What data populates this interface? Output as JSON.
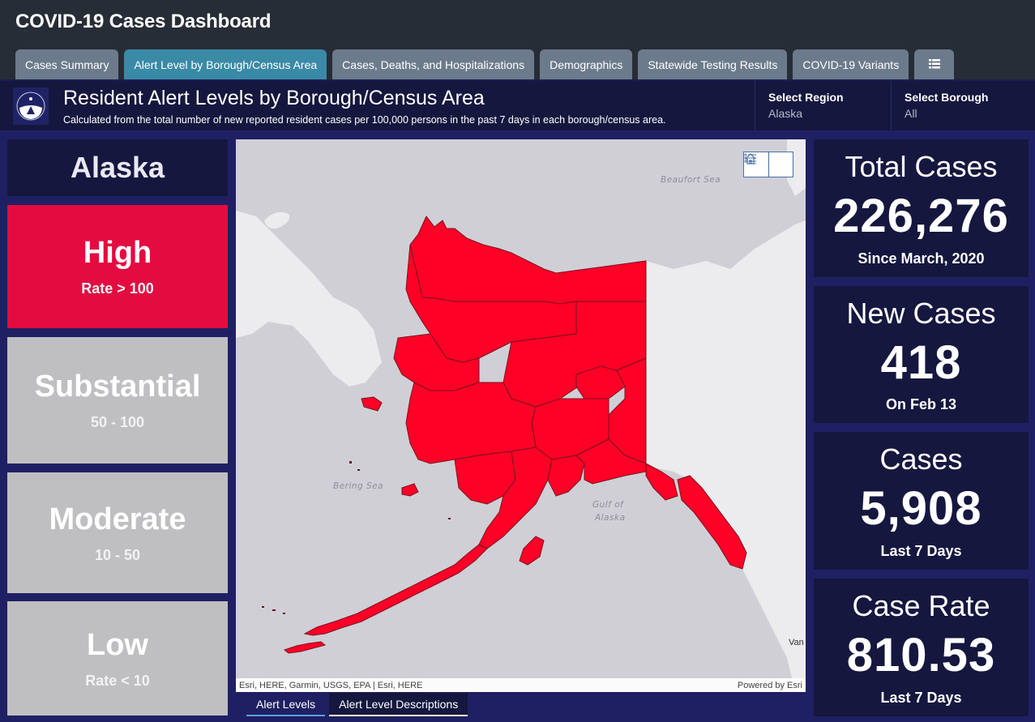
{
  "app": {
    "title": "COVID-19 Cases Dashboard"
  },
  "tabs": [
    {
      "label": "Cases Summary",
      "active": false
    },
    {
      "label": "Alert Level by Borough/Census Area",
      "active": true
    },
    {
      "label": "Cases, Deaths, and Hospitalizations",
      "active": false
    },
    {
      "label": "Demographics",
      "active": false
    },
    {
      "label": "Statewide Testing Results",
      "active": false
    },
    {
      "label": "COVID-19 Variants",
      "active": false
    },
    {
      "label": "☰",
      "icon": "list-menu-icon",
      "active": false
    }
  ],
  "header": {
    "title": "Resident Alert Levels by Borough/Census Area",
    "subtitle": "Calculated from the total number of new reported resident cases per 100,000 persons in the past 7 days in each borough/census area.",
    "logo": "state-of-alaska-seal",
    "region_selector": {
      "label": "Select Region",
      "value": "Alaska"
    },
    "borough_selector": {
      "label": "Select Borough",
      "value": "All"
    }
  },
  "left_panel": {
    "region": "Alaska",
    "levels": [
      {
        "name": "High",
        "range": "Rate > 100",
        "color": "#e30b40",
        "active": true
      },
      {
        "name": "Substantial",
        "range": "50 - 100",
        "color": "#bfbfc2",
        "active": false
      },
      {
        "name": "Moderate",
        "range": "10 - 50",
        "color": "#bfbfc2",
        "active": false
      },
      {
        "name": "Low",
        "range": "Rate < 10",
        "color": "#bfbfc2",
        "active": false
      }
    ]
  },
  "map": {
    "fill_color": "#ff0026",
    "labels": {
      "beaufort": "Beaufort Sea",
      "bering": "Bering Sea",
      "gulf_line1": "Gulf of",
      "gulf_line2": "Alaska",
      "city": "Van"
    },
    "controls": {
      "home": "home-icon",
      "legend": "legend-list-icon"
    },
    "attribution_left": "Esri, HERE, Garmin, USGS, EPA | Esri, HERE",
    "attribution_right": "Powered by Esri"
  },
  "bottom_tabs": [
    {
      "label": "Alert Levels",
      "active": true
    },
    {
      "label": "Alert Level Descriptions",
      "active": false
    }
  ],
  "stats": [
    {
      "title": "Total Cases",
      "value": "226,276",
      "sub": "Since March, 2020"
    },
    {
      "title": "New Cases",
      "value": "418",
      "sub": "On Feb 13"
    },
    {
      "title": "Cases",
      "value": "5,908",
      "sub": "Last 7 Days"
    },
    {
      "title": "Case Rate",
      "value": "810.53",
      "sub": "Last 7 Days"
    }
  ],
  "colors": {
    "topbar": "#272d36",
    "tab": "#6c7b8c",
    "tab_active": "#3a8aa6",
    "panel_bg": "#15173f",
    "page_bg": "#1f2063",
    "high": "#e30b40",
    "inactive_level": "#bfbfc2"
  }
}
